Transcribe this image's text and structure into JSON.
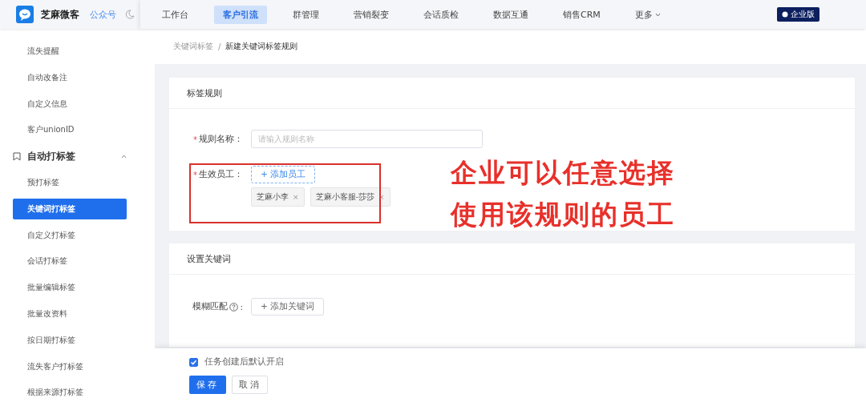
{
  "brand": {
    "name": "芝麻微客",
    "link": "公众号"
  },
  "nav": [
    {
      "label": "工作台",
      "selected": false,
      "kind": "plain"
    },
    {
      "label": "客户引流",
      "selected": true,
      "kind": "plain"
    },
    {
      "label": "群管理",
      "selected": false,
      "kind": "plain"
    },
    {
      "label": "营销裂变",
      "selected": false,
      "kind": "plain"
    },
    {
      "label": "会话质检",
      "selected": false,
      "kind": "plain"
    },
    {
      "label": "数据互通",
      "selected": false,
      "kind": "plain"
    },
    {
      "label": "销售CRM",
      "selected": false,
      "kind": "plain"
    },
    {
      "label": "更多",
      "selected": false,
      "kind": "dropdown"
    }
  ],
  "edition_badge": "企业版",
  "sidebar": {
    "items": [
      {
        "label": "流失提醒",
        "kind": "item",
        "selected": false
      },
      {
        "label": "自动改备注",
        "kind": "item",
        "selected": false
      },
      {
        "label": "自定义信息",
        "kind": "item",
        "selected": false
      },
      {
        "label": "客户unionID",
        "kind": "item",
        "selected": false
      },
      {
        "label": "自动打标签",
        "kind": "group",
        "expanded": true
      },
      {
        "label": "预打标签",
        "kind": "item",
        "selected": false
      },
      {
        "label": "关键词打标签",
        "kind": "item",
        "selected": true
      },
      {
        "label": "自定义打标签",
        "kind": "item",
        "selected": false
      },
      {
        "label": "会话打标签",
        "kind": "item",
        "selected": false
      },
      {
        "label": "批量编辑标签",
        "kind": "item",
        "selected": false
      },
      {
        "label": "批量改资料",
        "kind": "item",
        "selected": false
      },
      {
        "label": "按日期打标签",
        "kind": "item",
        "selected": false
      },
      {
        "label": "流失客户打标签",
        "kind": "item",
        "selected": false
      },
      {
        "label": "根据来源打标签",
        "kind": "item",
        "selected": false
      }
    ]
  },
  "breadcrumb": {
    "items": [
      "关键词标签",
      "新建关键词标签规则"
    ],
    "separator": "/"
  },
  "rule_card": {
    "title": "标签规则",
    "name_field": {
      "label": "规则名称：",
      "required_mark": "*",
      "placeholder": "请输入规则名称"
    },
    "staff_field": {
      "label": "生效员工：",
      "required_mark": "*",
      "add_button": "+ 添加员工",
      "tags": [
        {
          "label": "芝麻小李",
          "remove": "×"
        },
        {
          "label": "芝麻小客服-莎莎",
          "remove": "×"
        }
      ]
    }
  },
  "annotation": {
    "lines": [
      "企业可以任意选择",
      "使用该规则的员工"
    ]
  },
  "keyword_card": {
    "title": "设置关键词",
    "rows": [
      {
        "label": "模糊匹配",
        "colon": ":",
        "button": "+ 添加关键词"
      }
    ]
  },
  "footer": {
    "checkbox": {
      "label": "任务创建后默认开启",
      "checked": true
    },
    "save": "保存",
    "cancel": "取消"
  }
}
